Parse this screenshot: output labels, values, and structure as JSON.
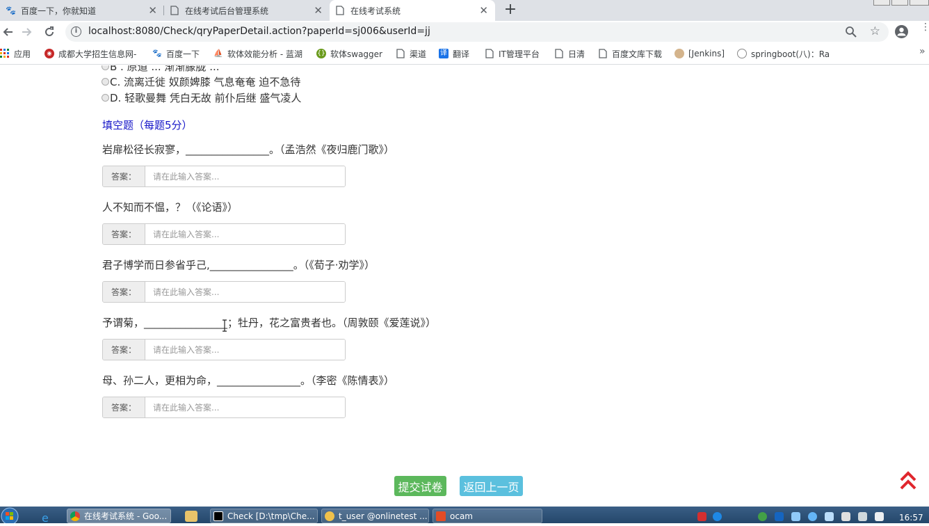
{
  "browser": {
    "tabs": [
      {
        "title": "百度一下，你就知道",
        "icon": "baidu-paw-icon"
      },
      {
        "title": "在线考试后台管理系统",
        "icon": "page-icon"
      },
      {
        "title": "在线考试系统",
        "icon": "page-icon"
      }
    ],
    "new_tab": "+",
    "url": "localhost:8080/Check/qryPaperDetail.action?paperId=sj006&userId=jj"
  },
  "bookmarks": [
    {
      "label": "应用",
      "icon": "apps-grid-icon"
    },
    {
      "label": "成都大学招生信息网-",
      "icon": "university-icon"
    },
    {
      "label": "百度一下",
      "icon": "baidu-paw-icon"
    },
    {
      "label": "软体效能分析 - 蓝湖",
      "icon": "lanhu-icon"
    },
    {
      "label": "软体swagger",
      "icon": "swagger-icon"
    },
    {
      "label": "渠道",
      "icon": "page-icon"
    },
    {
      "label": "翻译",
      "icon": "translate-icon"
    },
    {
      "label": "IT管理平台",
      "icon": "page-icon"
    },
    {
      "label": "日清",
      "icon": "page-icon"
    },
    {
      "label": "百度文库下载",
      "icon": "page-icon"
    },
    {
      "label": "[Jenkins]",
      "icon": "jenkins-icon"
    },
    {
      "label": "springboot(八)：Ra",
      "icon": "springboot-icon"
    }
  ],
  "page": {
    "options": [
      {
        "text": "B . 原道 ... 渐渐朦胧 ..."
      },
      {
        "text": "C. 流离迁徙 奴颜婢膝 气息奄奄 迫不急待"
      },
      {
        "text": "D. 轻歌曼舞 凭白无故 前仆后继 盛气凌人"
      }
    ],
    "section_title": "填空题（每题5分）",
    "answer_label": "答案：",
    "answer_placeholder": "请在此输入答案...",
    "questions": [
      {
        "text": "岩扉松径长寂寥，________________。（孟浩然《夜归鹿门歌》）"
      },
      {
        "text": "人不知而不愠，？（《论语》）"
      },
      {
        "text": "君子博学而日参省乎己,________________。（《荀子·劝学》）"
      },
      {
        "text": "予谓菊，________________；牡丹，花之富贵者也。（周敦颐《爱莲说》）"
      },
      {
        "text": "母、孙二人，更相为命，________________。（李密《陈情表》）"
      }
    ],
    "submit_button": "提交试卷",
    "back_button": "返回上一页"
  },
  "taskbar": {
    "items": [
      {
        "label": "在线考试系统 - Goo...",
        "icon": "chrome-icon"
      },
      {
        "label": "Check [D:\\tmp\\Che...",
        "icon": "intellij-icon"
      },
      {
        "label": "t_user @onlinetest ...",
        "icon": "database-icon"
      },
      {
        "label": "ocam",
        "icon": "ocam-icon"
      }
    ],
    "clock": "16:57"
  },
  "colors": {
    "section_title": "#1515c8",
    "submit_button": "#5cb85c",
    "back_button": "#5bc0de",
    "back_to_top": "#e0262d"
  }
}
